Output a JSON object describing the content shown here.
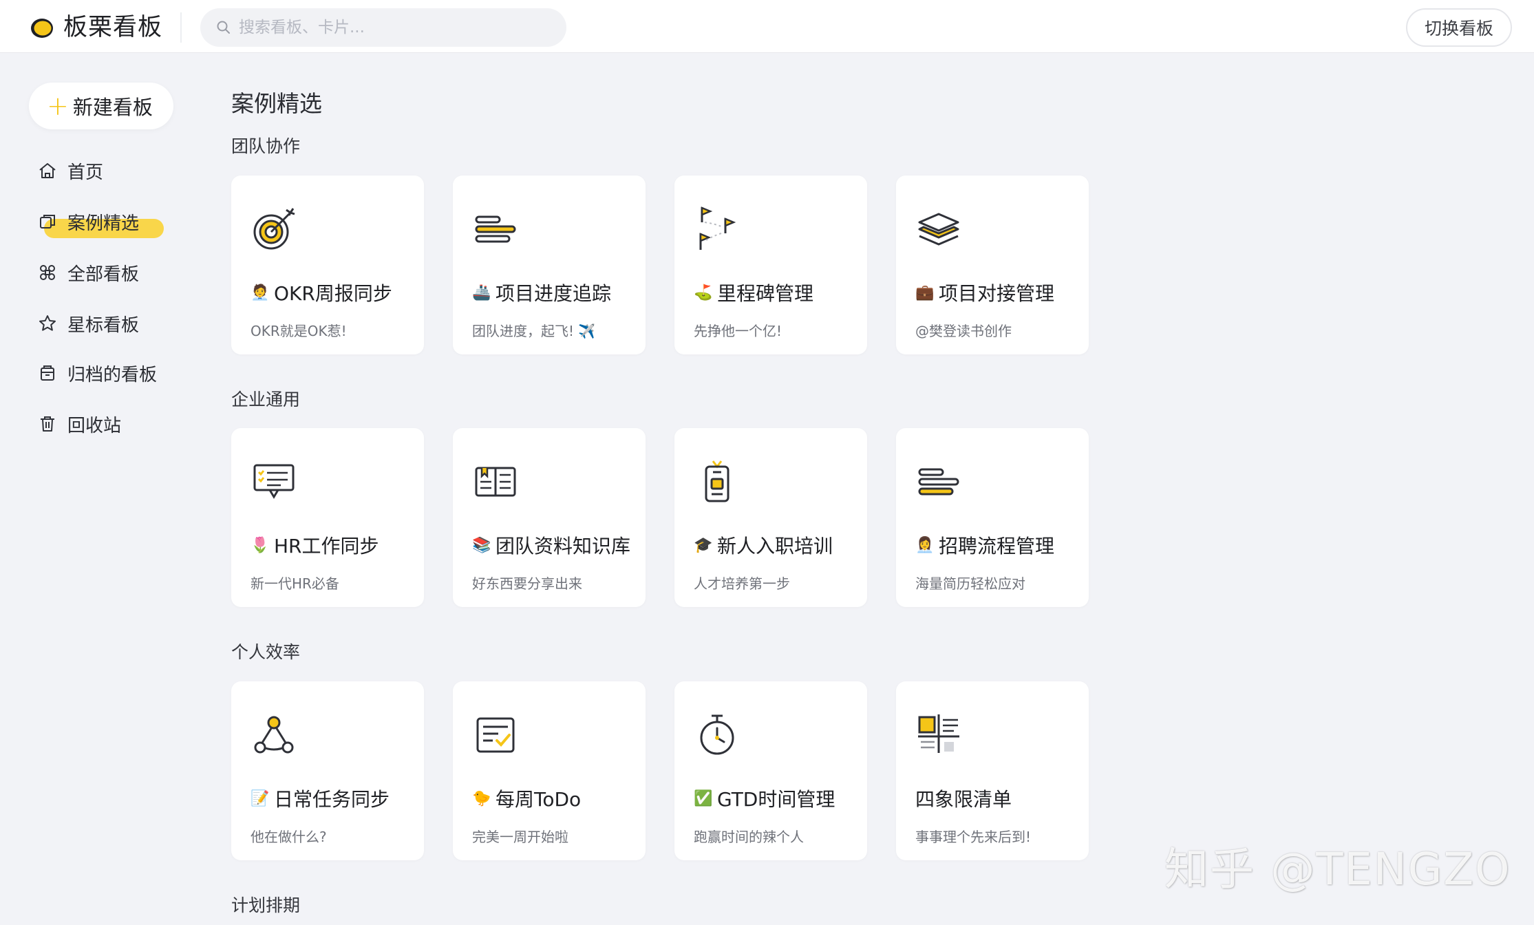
{
  "header": {
    "app_name": "板栗看板",
    "search_placeholder": "搜索看板、卡片...",
    "switch_label": "切换看板"
  },
  "sidebar": {
    "new_board_label": "新建看板",
    "items": [
      {
        "label": "首页",
        "icon": "home-icon"
      },
      {
        "label": "案例精选",
        "icon": "copy-icon",
        "active": true
      },
      {
        "label": "全部看板",
        "icon": "command-icon"
      },
      {
        "label": "星标看板",
        "icon": "star-icon"
      },
      {
        "label": "归档的看板",
        "icon": "archive-icon"
      },
      {
        "label": "回收站",
        "icon": "trash-icon"
      }
    ]
  },
  "main": {
    "title": "案例精选",
    "sections": [
      {
        "title": "团队协作",
        "cards": [
          {
            "emoji": "🧑‍💼",
            "title": "OKR周报同步",
            "subtitle": "OKR就是OK惹!",
            "icon": "target-icon"
          },
          {
            "emoji": "🚢",
            "title": "项目进度追踪",
            "subtitle": "团队进度，起飞! ✈️",
            "icon": "progress-bars-icon"
          },
          {
            "emoji": "⛳",
            "title": "里程碑管理",
            "subtitle": "先挣他一个亿!",
            "icon": "flags-icon"
          },
          {
            "emoji": "💼",
            "title": "项目对接管理",
            "subtitle": "@樊登读书创作",
            "icon": "layers-icon"
          }
        ]
      },
      {
        "title": "企业通用",
        "cards": [
          {
            "emoji": "🌷",
            "title": "HR工作同步",
            "subtitle": "新一代HR必备",
            "icon": "presentation-icon"
          },
          {
            "emoji": "📚",
            "title": "团队资料知识库",
            "subtitle": "好东西要分享出来",
            "icon": "book-icon"
          },
          {
            "emoji": "🎓",
            "title": "新人入职培训",
            "subtitle": "人才培养第一步",
            "icon": "badge-icon"
          },
          {
            "emoji": "👩‍💼",
            "title": "招聘流程管理",
            "subtitle": "海量简历轻松应对",
            "icon": "progress-bars-icon"
          }
        ]
      },
      {
        "title": "个人效率",
        "cards": [
          {
            "emoji": "📝",
            "title": "日常任务同步",
            "subtitle": "他在做什么?",
            "icon": "network-icon"
          },
          {
            "emoji": "🐤",
            "title": "每周ToDo",
            "subtitle": "完美一周开始啦",
            "icon": "checklist-icon"
          },
          {
            "emoji": "✅",
            "title": "GTD时间管理",
            "subtitle": "跑赢时间的辣个人",
            "icon": "stopwatch-icon"
          },
          {
            "emoji": "",
            "title": "四象限清单",
            "subtitle": "事事理个先来后到!",
            "icon": "quadrant-icon"
          }
        ]
      },
      {
        "title": "计划排期",
        "cards": []
      }
    ]
  },
  "watermark": "知乎 @TENGZO",
  "colors": {
    "accent": "#f5c518",
    "highlight": "#f9d64a",
    "background": "#f2f3f7",
    "card": "#ffffff",
    "icon_stroke": "#2f3138"
  }
}
